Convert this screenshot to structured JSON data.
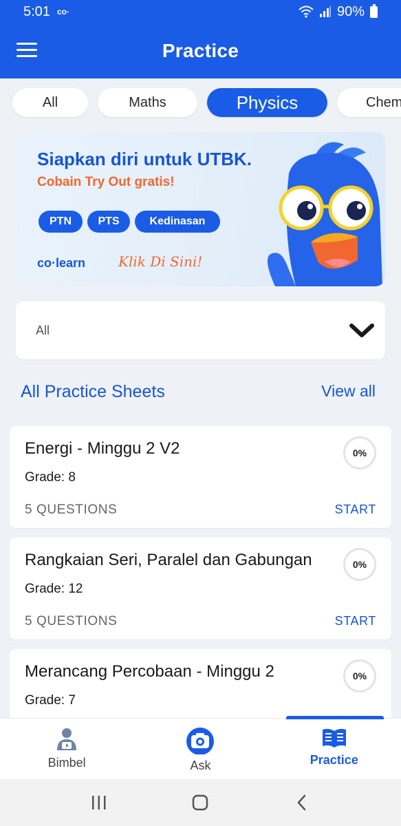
{
  "status_bar": {
    "time": "5:01",
    "app_mark": "co·",
    "battery": "90%"
  },
  "app_bar": {
    "title": "Practice"
  },
  "chips": [
    "All",
    "Maths",
    "Physics",
    "Chem"
  ],
  "active_chip": "Physics",
  "banner": {
    "title": "Siapkan diri untuk UTBK.",
    "subtitle": "Cobain Try Out gratis!",
    "pills": [
      "PTN",
      "PTS",
      "Kedinasan"
    ],
    "logo": "co·learn",
    "cta": "Klik Di Sini!"
  },
  "filter_dropdown": {
    "value": "All"
  },
  "section": {
    "title": "All Practice Sheets",
    "view_all": "View all"
  },
  "practice_sheets": [
    {
      "title": "Energi - Minggu 2 V2",
      "grade": "Grade: 8",
      "questions": "5 QUESTIONS",
      "action": "START",
      "progress": "0%"
    },
    {
      "title": "Rangkaian Seri, Paralel dan Gabungan",
      "grade": "Grade: 12",
      "questions": "5 QUESTIONS",
      "action": "START",
      "progress": "0%"
    },
    {
      "title": "Merancang Percobaan - Minggu 2",
      "grade": "Grade: 7",
      "questions": "",
      "action": "",
      "progress": "0%"
    }
  ],
  "bottom_nav": [
    {
      "label": "Bimbel",
      "icon": "tutor-icon"
    },
    {
      "label": "Ask",
      "icon": "camera-icon"
    },
    {
      "label": "Practice",
      "icon": "book-icon"
    }
  ],
  "active_nav": "Practice",
  "colors": {
    "primary": "#1a5ce6",
    "accent": "#f0672f",
    "background": "#eef2f6"
  }
}
